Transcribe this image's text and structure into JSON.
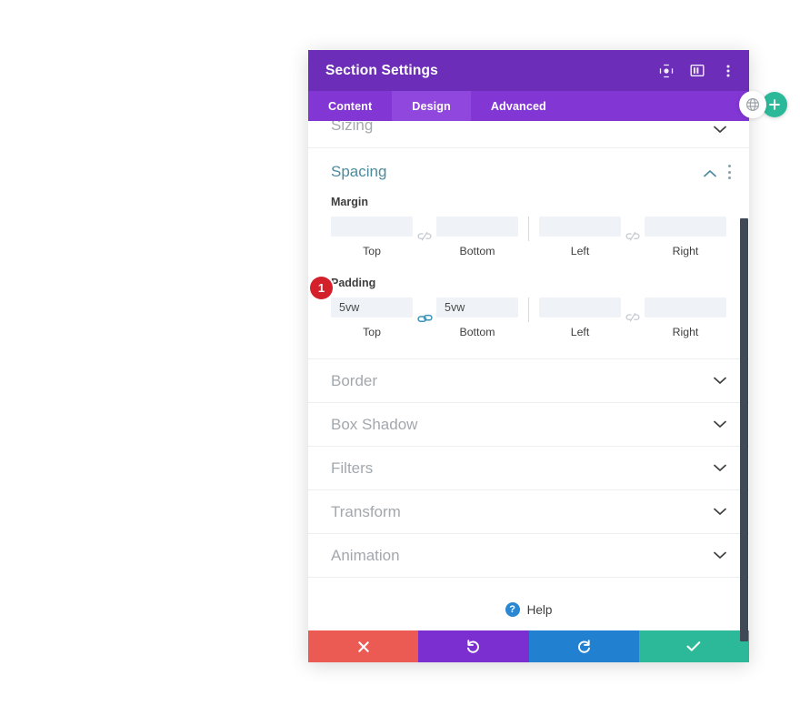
{
  "window": {
    "title": "Section Settings",
    "header_icons": [
      {
        "name": "focus-target-icon",
        "glyph": "target"
      },
      {
        "name": "layout-panel-icon",
        "glyph": "panel"
      },
      {
        "name": "more-options-icon",
        "glyph": "kebab"
      }
    ]
  },
  "tabs": [
    {
      "label": "Content",
      "active": false
    },
    {
      "label": "Design",
      "active": true
    },
    {
      "label": "Advanced",
      "active": false
    }
  ],
  "sections": {
    "sizing": {
      "label": "Sizing",
      "state": "collapsed"
    },
    "spacing": {
      "label": "Spacing",
      "state": "expanded"
    },
    "collapsed_list": [
      {
        "label": "Border",
        "state": "collapsed"
      },
      {
        "label": "Box Shadow",
        "state": "collapsed"
      },
      {
        "label": "Filters",
        "state": "collapsed"
      },
      {
        "label": "Transform",
        "state": "collapsed"
      },
      {
        "label": "Animation",
        "state": "collapsed"
      }
    ]
  },
  "spacing": {
    "margin": {
      "label": "Margin",
      "top": {
        "caption": "Top",
        "value": "",
        "placeholder": ""
      },
      "bottom": {
        "caption": "Bottom",
        "value": "",
        "placeholder": ""
      },
      "left": {
        "caption": "Left",
        "value": "",
        "placeholder": ""
      },
      "right": {
        "caption": "Right",
        "value": "",
        "placeholder": ""
      },
      "link_top_bottom": "unlinked",
      "link_left_right": "unlinked"
    },
    "padding": {
      "label": "Padding",
      "top": {
        "caption": "Top",
        "value": "5vw",
        "placeholder": ""
      },
      "bottom": {
        "caption": "Bottom",
        "value": "5vw",
        "placeholder": ""
      },
      "left": {
        "caption": "Left",
        "value": "",
        "placeholder": ""
      },
      "right": {
        "caption": "Right",
        "value": "",
        "placeholder": ""
      },
      "link_top_bottom": "linked",
      "link_left_right": "unlinked"
    }
  },
  "step_badge": {
    "number": "1"
  },
  "help": {
    "label": "Help",
    "icon_glyph": "?"
  },
  "footer": [
    {
      "name": "cancel-button",
      "icon": "cross",
      "color": "#eb5b54"
    },
    {
      "name": "undo-button",
      "icon": "undo",
      "color": "#7b2fd1"
    },
    {
      "name": "redo-button",
      "icon": "redo",
      "color": "#2180cf"
    },
    {
      "name": "save-button",
      "icon": "checkmark",
      "color": "#2cb99a"
    }
  ],
  "floating": {
    "globe": {
      "name": "globe-icon"
    },
    "add": {
      "name": "add-module-button",
      "glyph": "+"
    }
  },
  "colors": {
    "header_purple": "#6C2EB9",
    "tab_bar_purple": "#8236d4",
    "tab_active_purple": "#9047dd",
    "section_open_teal": "#4d8a9e",
    "section_label_gray": "#a3a8ad",
    "input_bg": "#eff2f6",
    "badge_red": "#d4202b",
    "link_active_blue": "#3a93b8",
    "scrollbar": "#3f4a56"
  }
}
